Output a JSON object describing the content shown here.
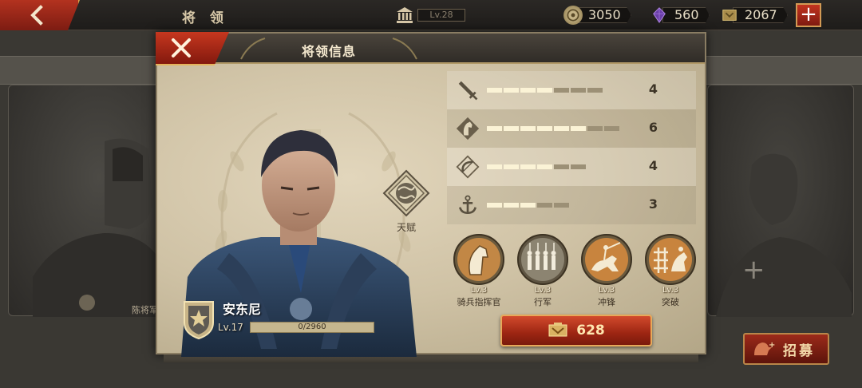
{
  "topbar": {
    "title": "将 领",
    "level": "Lv.28",
    "resources": [
      {
        "name": "gold",
        "icon": "gold-coin-icon",
        "amount": "3050"
      },
      {
        "name": "gem",
        "icon": "purple-gem-icon",
        "amount": "560"
      },
      {
        "name": "medal",
        "icon": "medal-icon",
        "amount": "2067"
      }
    ]
  },
  "background": {
    "caption": "陈将军",
    "recruit_label": "招募"
  },
  "modal": {
    "title": "将领信息",
    "talent_label": "天赋",
    "hero": {
      "name": "安东尼",
      "level": "Lv.17",
      "xp_text": "0/2960",
      "xp_progress": 0
    },
    "stats": [
      {
        "icon": "sword-icon",
        "value": "4",
        "filled": 4,
        "total": 7
      },
      {
        "icon": "horse-icon",
        "value": "6",
        "filled": 6,
        "total": 8
      },
      {
        "icon": "bow-icon",
        "value": "4",
        "filled": 4,
        "total": 6
      },
      {
        "icon": "anchor-icon",
        "value": "3",
        "filled": 3,
        "total": 5
      }
    ],
    "skills": [
      {
        "icon": "cavalry-commander-icon",
        "level": "Lv.3",
        "name": "骑兵指挥官"
      },
      {
        "icon": "march-icon",
        "level": "Lv.3",
        "name": "行军"
      },
      {
        "icon": "charge-icon",
        "level": "Lv.3",
        "name": "冲锋"
      },
      {
        "icon": "breakthrough-icon",
        "level": "Lv.3",
        "name": "突破"
      }
    ],
    "cost": "628"
  },
  "colors": {
    "accent_red": "#b3321f",
    "gold_trim": "#d9a44a",
    "bar_filled": "#fbf3d6",
    "bar_empty": "#9c9076"
  }
}
